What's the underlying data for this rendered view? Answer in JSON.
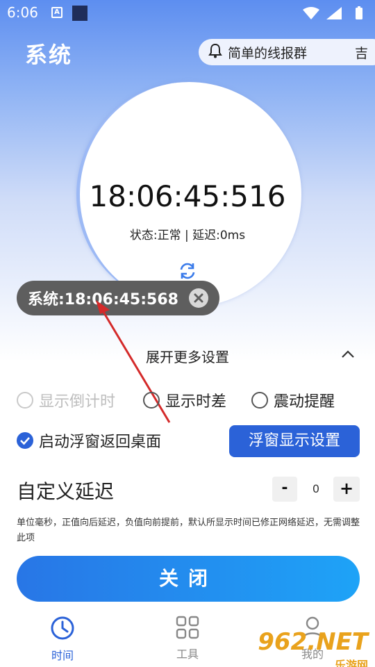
{
  "status_bar": {
    "time": "6:06",
    "a_label": "A"
  },
  "header": {
    "title": "系统",
    "notice_text": "简单的线报群",
    "notice_right": "吉"
  },
  "clock": {
    "time": "18:06:45:516",
    "status": "状态:正常 | 延迟:0ms"
  },
  "floating_window": {
    "text": "系统:18:06:45:568"
  },
  "settings": {
    "expand_label": "展开更多设置",
    "options": [
      {
        "label": "显示倒计时",
        "checked": false,
        "disabled": true
      },
      {
        "label": "显示时差",
        "checked": false,
        "disabled": false
      },
      {
        "label": "震动提醒",
        "checked": false,
        "disabled": false
      }
    ],
    "float_return_label": "启动浮窗返回桌面",
    "float_settings_label": "浮窗显示设置",
    "delay_label": "自定义延迟",
    "delay_minus": "-",
    "delay_value": "0",
    "delay_plus": "+",
    "delay_desc": "单位毫秒，正值向后延迟，负值向前提前，默认所显示时间已修正网络延迟，无需调整此项",
    "close_label": "关闭"
  },
  "bottom_nav": {
    "items": [
      {
        "label": "时间",
        "icon": "clock-icon",
        "active": true
      },
      {
        "label": "工具",
        "icon": "grid-icon",
        "active": false
      },
      {
        "label": "我的",
        "icon": "user-icon",
        "active": false
      }
    ]
  },
  "watermark": {
    "main": "962.NET",
    "sub": "乐游网"
  },
  "colors": {
    "accent": "#2b62d8",
    "arrow": "#d42a2a"
  }
}
